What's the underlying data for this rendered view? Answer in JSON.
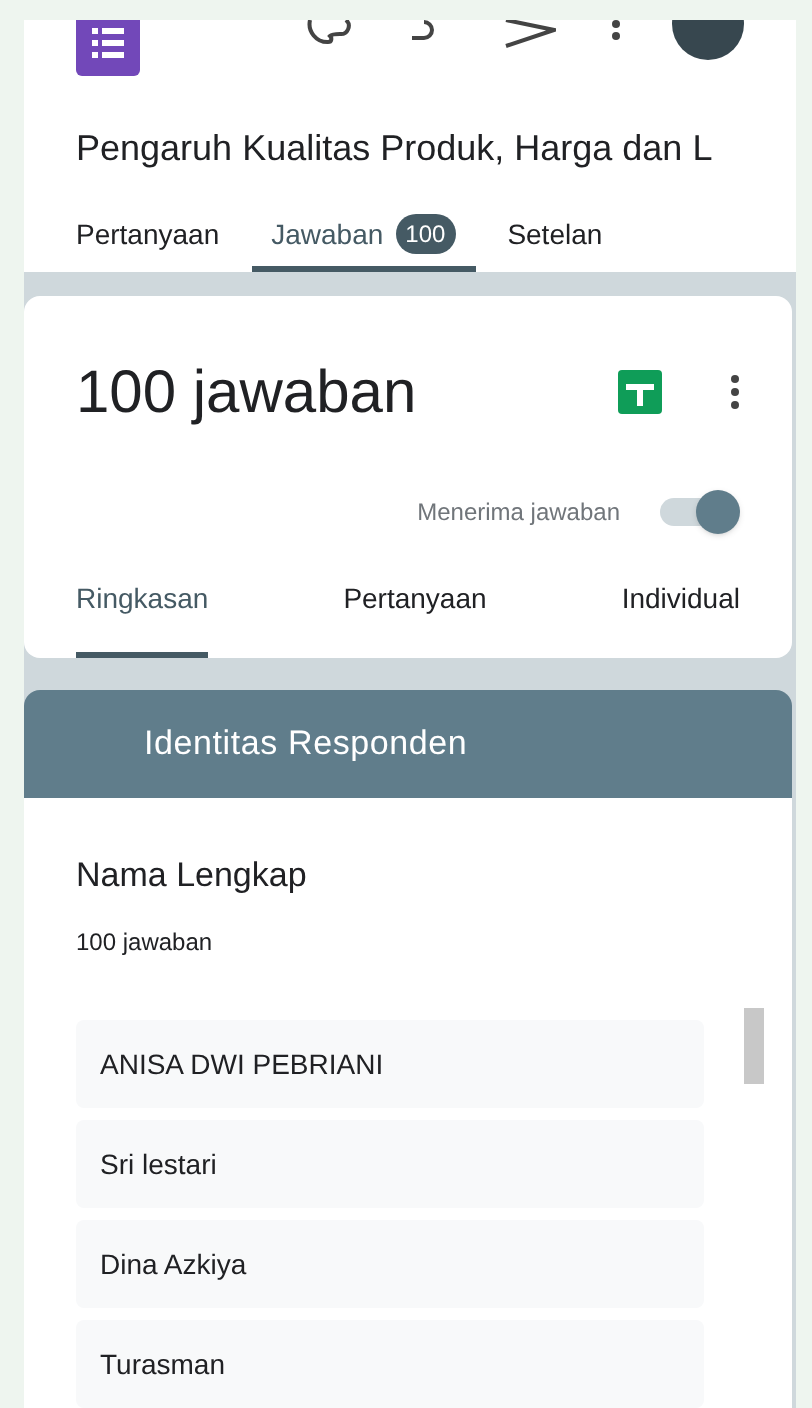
{
  "form_title": "Pengaruh Kualitas Produk, Harga dan L",
  "tabs": [
    {
      "label": "Pertanyaan",
      "selected": false
    },
    {
      "label": "Jawaban",
      "selected": true,
      "badge": "100"
    },
    {
      "label": "Setelan",
      "selected": false
    }
  ],
  "summary": {
    "title": "100 jawaban",
    "accepting_label": "Menerima jawaban",
    "accepting": true
  },
  "view_tabs": [
    {
      "label": "Ringkasan",
      "selected": true
    },
    {
      "label": "Pertanyaan",
      "selected": false
    },
    {
      "label": "Individual",
      "selected": false
    }
  ],
  "section": {
    "title": "Identitas Responden"
  },
  "question": {
    "title": "Nama Lengkap",
    "count": "100 jawaban",
    "answers": [
      "ANISA DWI PEBRIANI",
      "Sri lestari",
      "Dina Azkiya",
      "Turasman"
    ]
  }
}
